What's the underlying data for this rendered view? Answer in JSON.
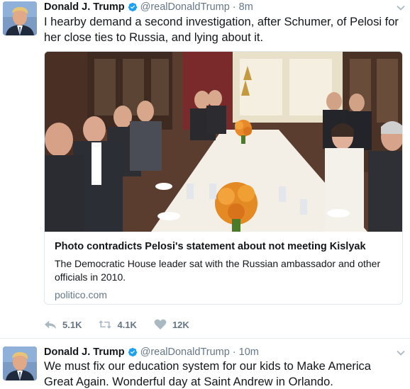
{
  "tweets": [
    {
      "name": "Donald J. Trump",
      "handle": "@realDonaldTrump",
      "separator": "·",
      "time": "8m",
      "text": "I hearby demand a second investigation, after Schumer, of Pelosi for her close ties to Russia, and lying about it.",
      "card": {
        "title": "Photo contradicts Pelosi's statement about not meeting Kislyak",
        "description": "The Democratic House leader sat with the Russian ambassador and other officials in 2010.",
        "domain": "politico.com"
      },
      "actions": {
        "reply_count": "5.1K",
        "retweet_count": "4.1K",
        "like_count": "12K"
      }
    },
    {
      "name": "Donald J. Trump",
      "handle": "@realDonaldTrump",
      "separator": "·",
      "time": "10m",
      "text": "We must fix our education system for our kids to Make America Great Again. Wonderful day at Saint Andrew in Orlando."
    }
  ],
  "icons": {
    "verified": "verified-badge-icon",
    "caret": "chevron-down-icon",
    "reply": "reply-icon",
    "retweet": "retweet-icon",
    "like": "heart-icon"
  },
  "colors": {
    "verified": "#1da1f2",
    "secondary_text": "#657786",
    "primary_text": "#14171a",
    "border": "#e1e8ed"
  }
}
